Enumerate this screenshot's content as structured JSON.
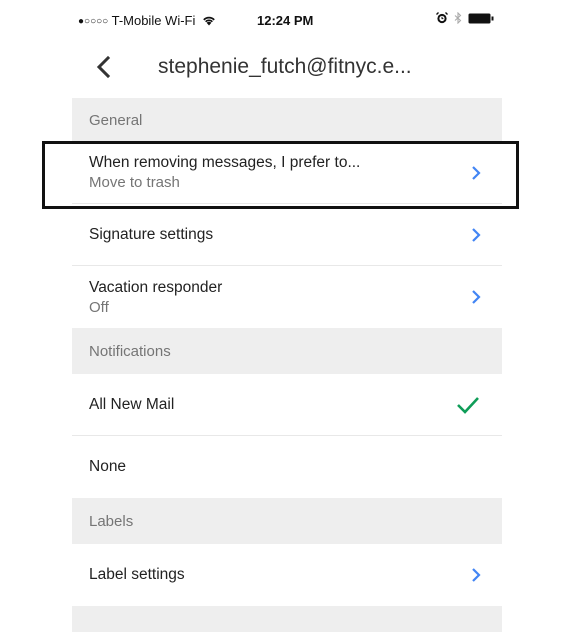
{
  "status_bar": {
    "signal_dots": "●○○○○",
    "carrier": "T-Mobile Wi-Fi",
    "time": "12:24 PM"
  },
  "header": {
    "title": "stephenie_futch@fitnyc.e..."
  },
  "sections": {
    "general": "General",
    "notifications": "Notifications",
    "labels": "Labels"
  },
  "rows": {
    "removing": {
      "primary": "When removing messages, I prefer to...",
      "secondary": "Move to trash"
    },
    "signature": {
      "primary": "Signature settings"
    },
    "vacation": {
      "primary": "Vacation responder",
      "secondary": "Off"
    },
    "all_new_mail": {
      "primary": "All New Mail"
    },
    "none": {
      "primary": "None"
    },
    "label_settings": {
      "primary": "Label settings"
    }
  },
  "colors": {
    "accent_chevron": "#4285f4",
    "check": "#0f9d58",
    "section_bg": "#eeeeee"
  },
  "icons": [
    "wifi-icon",
    "alarm-icon",
    "bluetooth-icon",
    "battery-icon",
    "back-arrow-icon",
    "chevron-right-icon",
    "checkmark-icon"
  ]
}
